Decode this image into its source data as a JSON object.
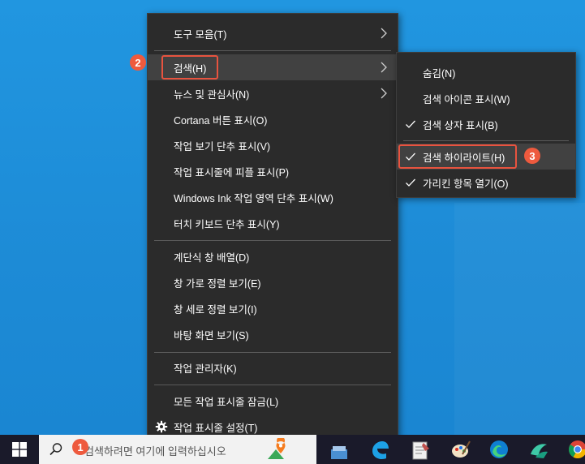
{
  "main_menu": {
    "items": [
      {
        "label": "도구 모음(T)",
        "has_submenu": true
      },
      {
        "label": "검색(H)",
        "has_submenu": true,
        "highlighted": true
      },
      {
        "label": "뉴스 및 관심사(N)",
        "has_submenu": true
      },
      {
        "label": "Cortana 버튼 표시(O)"
      },
      {
        "label": "작업 보기 단추 표시(V)"
      },
      {
        "label": "작업 표시줄에 피플 표시(P)"
      },
      {
        "label": "Windows Ink 작업 영역 단추 표시(W)"
      },
      {
        "label": "터치 키보드 단추 표시(Y)"
      },
      {
        "label": "계단식 창 배열(D)"
      },
      {
        "label": "창 가로 정렬 보기(E)"
      },
      {
        "label": "창 세로 정렬 보기(I)"
      },
      {
        "label": "바탕 화면 보기(S)"
      },
      {
        "label": "작업 관리자(K)"
      },
      {
        "label": "모든 작업 표시줄 잠금(L)"
      },
      {
        "label": "작업 표시줄 설정(T)",
        "icon": "gear-icon"
      }
    ]
  },
  "search_submenu": {
    "items": [
      {
        "label": "숨김(N)",
        "checked": false
      },
      {
        "label": "검색 아이콘 표시(W)",
        "checked": false
      },
      {
        "label": "검색 상자 표시(B)",
        "checked": true
      },
      {
        "label": "검색 하이라이트(H)",
        "checked": true,
        "highlighted": true
      },
      {
        "label": "가리킨 항목 열기(O)",
        "checked": true
      }
    ]
  },
  "badges": {
    "one": "1",
    "two": "2",
    "three": "3"
  },
  "taskbar": {
    "search_placeholder": "검색하려면 여기에 입력하십시오",
    "icons": [
      "windows-start-icon",
      "search-icon",
      "file-explorer-icon",
      "edge-legacy-icon",
      "notepad-icon",
      "paint-icon",
      "edge-icon",
      "store-icon",
      "chrome-icon"
    ]
  },
  "colors": {
    "menu_bg": "#2b2b2b",
    "hover_bg": "#414141",
    "callout": "#ee5a3e",
    "desktop": "#1e8fd9"
  }
}
